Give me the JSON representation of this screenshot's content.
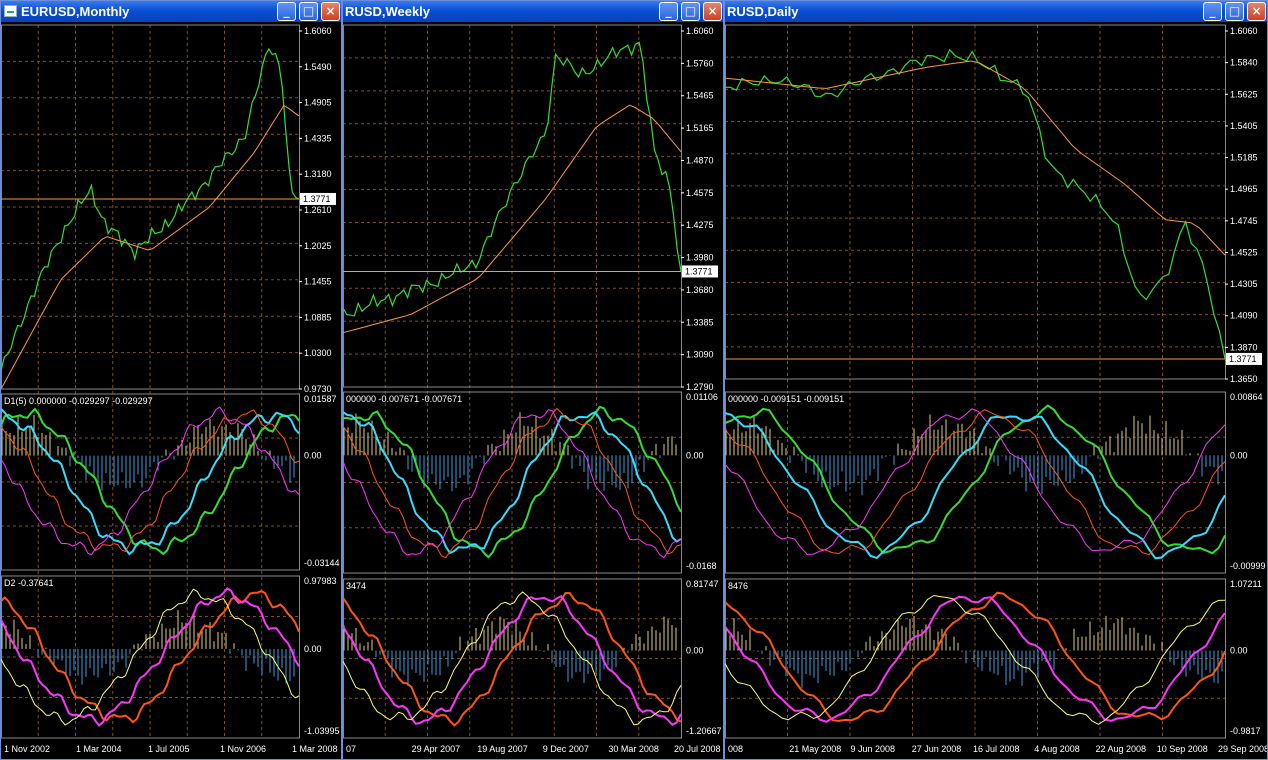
{
  "colors": {
    "background": "#000000",
    "grid": "#8a4a17",
    "axis": "#ffffff",
    "price": "#33dd33",
    "ma": "#ff9933",
    "cyan": "#33ddff",
    "orange": "#ff5511",
    "magenta": "#ff33ff",
    "yellow": "#ffff66",
    "histPos": "#e0d070",
    "histNeg": "#3aa0e0",
    "arrow": "#3a90ff"
  },
  "icons": {
    "app": "chart-window-icon",
    "minimize": "minimize-icon",
    "maximize": "maximize-icon",
    "close": "close-icon"
  },
  "buttons": {
    "minimize": "_",
    "maximize": "□",
    "close": "×"
  },
  "windows": [
    {
      "title": "EURUSD,Monthly",
      "currentPrice": "1.3771",
      "priceTicks": [
        "1.6060",
        "1.5490",
        "1.4905",
        "1.4335",
        "1.3180",
        "1.2610",
        "1.2025",
        "1.1455",
        "1.0885",
        "1.0300",
        "0.9730"
      ],
      "ind1": {
        "label": "D1(5) 0.000000 -0.029297 -0.029297",
        "ticks": [
          "0.01587",
          "0.00",
          "-0.03144"
        ]
      },
      "ind2": {
        "label": "D2 -0.37641",
        "ticks": [
          "0.97983",
          "0.00",
          "-1.03995"
        ]
      },
      "dates": [
        "1 Nov 2002",
        "1 Mar 2004",
        "1 Jul 2005",
        "1 Nov 2006",
        "1 Mar 2008"
      ]
    },
    {
      "title": "RUSD,Weekly",
      "currentPrice": "1.3771",
      "priceTicks": [
        "1.6060",
        "1.5760",
        "1.5465",
        "1.5165",
        "1.4870",
        "1.4575",
        "1.4275",
        "1.3980",
        "1.3680",
        "1.3385",
        "1.3090",
        "1.2790"
      ],
      "ind1": {
        "label": "000000 -0.007671 -0.007671",
        "ticks": [
          "0.01106",
          "0.00",
          "-0.0168"
        ]
      },
      "ind2": {
        "label": "3474",
        "ticks": [
          "0.81747",
          "0.00",
          "-1.20667"
        ]
      },
      "dates": [
        "07",
        "29 Apr 2007",
        "19 Aug 2007",
        "9 Dec 2007",
        "30 Mar 2008",
        "20 Jul 2008"
      ]
    },
    {
      "title": "RUSD,Daily",
      "currentPrice": "1.3771",
      "priceTicks": [
        "1.6060",
        "1.5840",
        "1.5625",
        "1.5405",
        "1.5185",
        "1.4965",
        "1.4745",
        "1.4525",
        "1.4305",
        "1.4090",
        "1.3870",
        "1.3650"
      ],
      "ind1": {
        "label": "000000 -0.009151 -0.009151",
        "ticks": [
          "0.00864",
          "0.00",
          "-0.00999"
        ]
      },
      "ind2": {
        "label": "8476",
        "ticks": [
          "1.07211",
          "0.00",
          "-0.9817"
        ]
      },
      "dates": [
        "008",
        "21 May 2008",
        "9 Jun 2008",
        "27 Jun 2008",
        "16 Jul 2008",
        "4 Aug 2008",
        "22 Aug 2008",
        "10 Sep 2008",
        "29 Sep 2008"
      ]
    }
  ]
}
